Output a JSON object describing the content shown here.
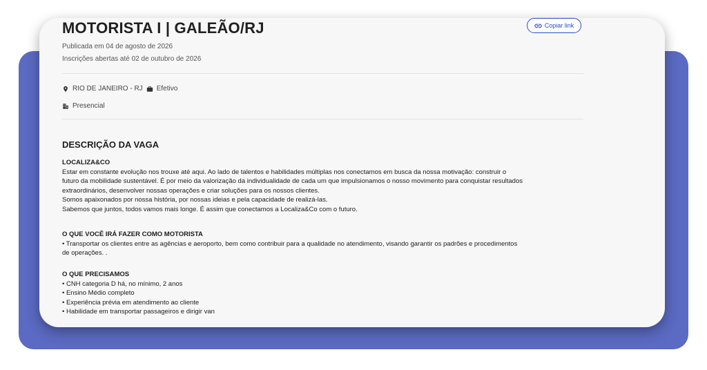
{
  "job": {
    "title": "MOTORISTA I | GALEÃO/RJ",
    "copy_link_label": "Copiar link",
    "published": "Publicada em 04 de agosto de 2026",
    "registrations": "Inscrições abertas até 02 de outubro de 2026",
    "location": "RIO DE JANEIRO - RJ",
    "contract_type": "Efetivo",
    "work_mode": "Presencial"
  },
  "description": {
    "section_title": "DESCRIÇÃO DA VAGA",
    "company_heading": "LOCALIZA&CO",
    "company_lines": [
      "Estar em constante evolução nos trouxe até aqui. Ao lado de talentos e habilidades múltiplas nos conectamos em busca da nossa motivação: construir o",
      "futuro da mobilidade sustentável. É por meio da valorização da individualidade de cada um que impulsionamos o nosso movimento para conquistar resultados",
      "extraordinários, desenvolver nossas operações e criar soluções para os nossos clientes.",
      "Somos apaixonados por nossa história, por nossas ideias e pela capacidade de realizá-las.",
      "Sabemos que juntos, todos vamos mais longe. É assim que conectamos a Localiza&Co com o futuro."
    ],
    "tasks_heading": "O QUE VOCÊ IRÁ FAZER COMO MOTORISTA",
    "tasks_lines": [
      "• Transportar os clientes entre as agências e aeroporto, bem como contribuir para a qualidade no atendimento, visando garantir os padrões e procedimentos",
      "de operações. ."
    ],
    "requirements_heading": "O QUE PRECISAMOS",
    "requirements": [
      "• CNH categoria D há, no mínimo, 2 anos",
      "• Ensino Médio completo",
      "• Experiência prévia em atendimento ao cliente",
      "• Habilidade em transportar passageiros e dirigir van"
    ]
  },
  "colors": {
    "backdrop": "#5b6ac2",
    "accent": "#2a4bb8"
  }
}
